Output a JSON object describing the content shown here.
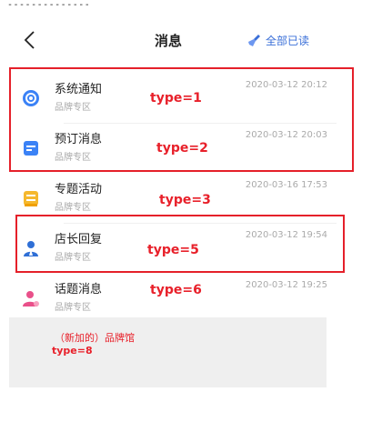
{
  "top_dashes": "--------------",
  "nav": {
    "title": "消息",
    "read_all": "全部已读"
  },
  "rows": [
    {
      "name": "系统通知",
      "sub": "品牌专区",
      "time": "2020-03-12 20:12",
      "type": "type=1",
      "icon": "blue-gear-icon"
    },
    {
      "name": "预订消息",
      "sub": "品牌专区",
      "time": "2020-03-12 20:03",
      "type": "type=2",
      "icon": "blue-card-icon"
    },
    {
      "name": "专题活动",
      "sub": "品牌专区",
      "time": "2020-03-16 17:53",
      "type": "type=3",
      "icon": "yellow-box-icon"
    },
    {
      "name": "店长回复",
      "sub": "品牌专区",
      "time": "2020-03-12 19:54",
      "type": "type=5",
      "icon": "blue-person-icon"
    },
    {
      "name": "话题消息",
      "sub": "品牌专区",
      "time": "2020-03-12 19:25",
      "type": "type=6",
      "icon": "pink-person-icon"
    }
  ],
  "gray_area": {
    "line1": "（新加的）品牌馆",
    "line2": "type=8"
  },
  "colors": {
    "accent": "#3a6fd8",
    "annotation_red": "#e8202a"
  }
}
